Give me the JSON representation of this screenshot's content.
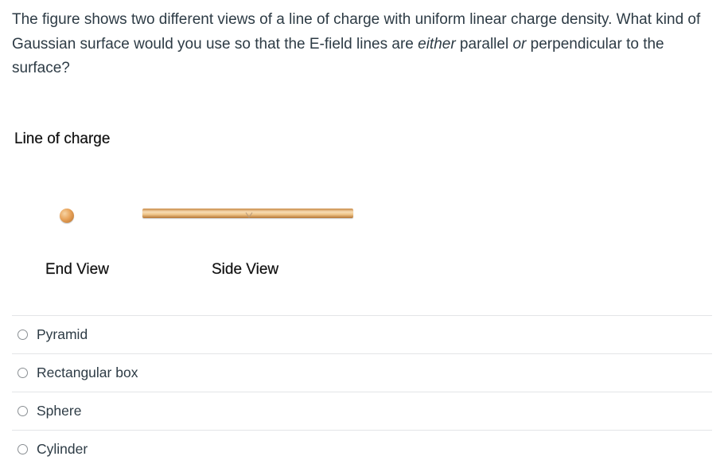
{
  "question": {
    "part1": "The figure shows two different views of a line of charge with uniform linear charge density.  What kind of Gaussian surface would you use so that the E-field lines are ",
    "emph1": "either",
    "part2": " parallel ",
    "emph2": "or",
    "part3": " perpendicular to the surface?"
  },
  "figure": {
    "title": "Line of charge",
    "end_view_label": "End View",
    "side_view_label": "Side View",
    "charge_color": "#e8a35a"
  },
  "answers": [
    {
      "label": "Pyramid",
      "selected": false
    },
    {
      "label": "Rectangular box",
      "selected": false
    },
    {
      "label": "Sphere",
      "selected": false
    },
    {
      "label": "Cylinder",
      "selected": false
    }
  ]
}
